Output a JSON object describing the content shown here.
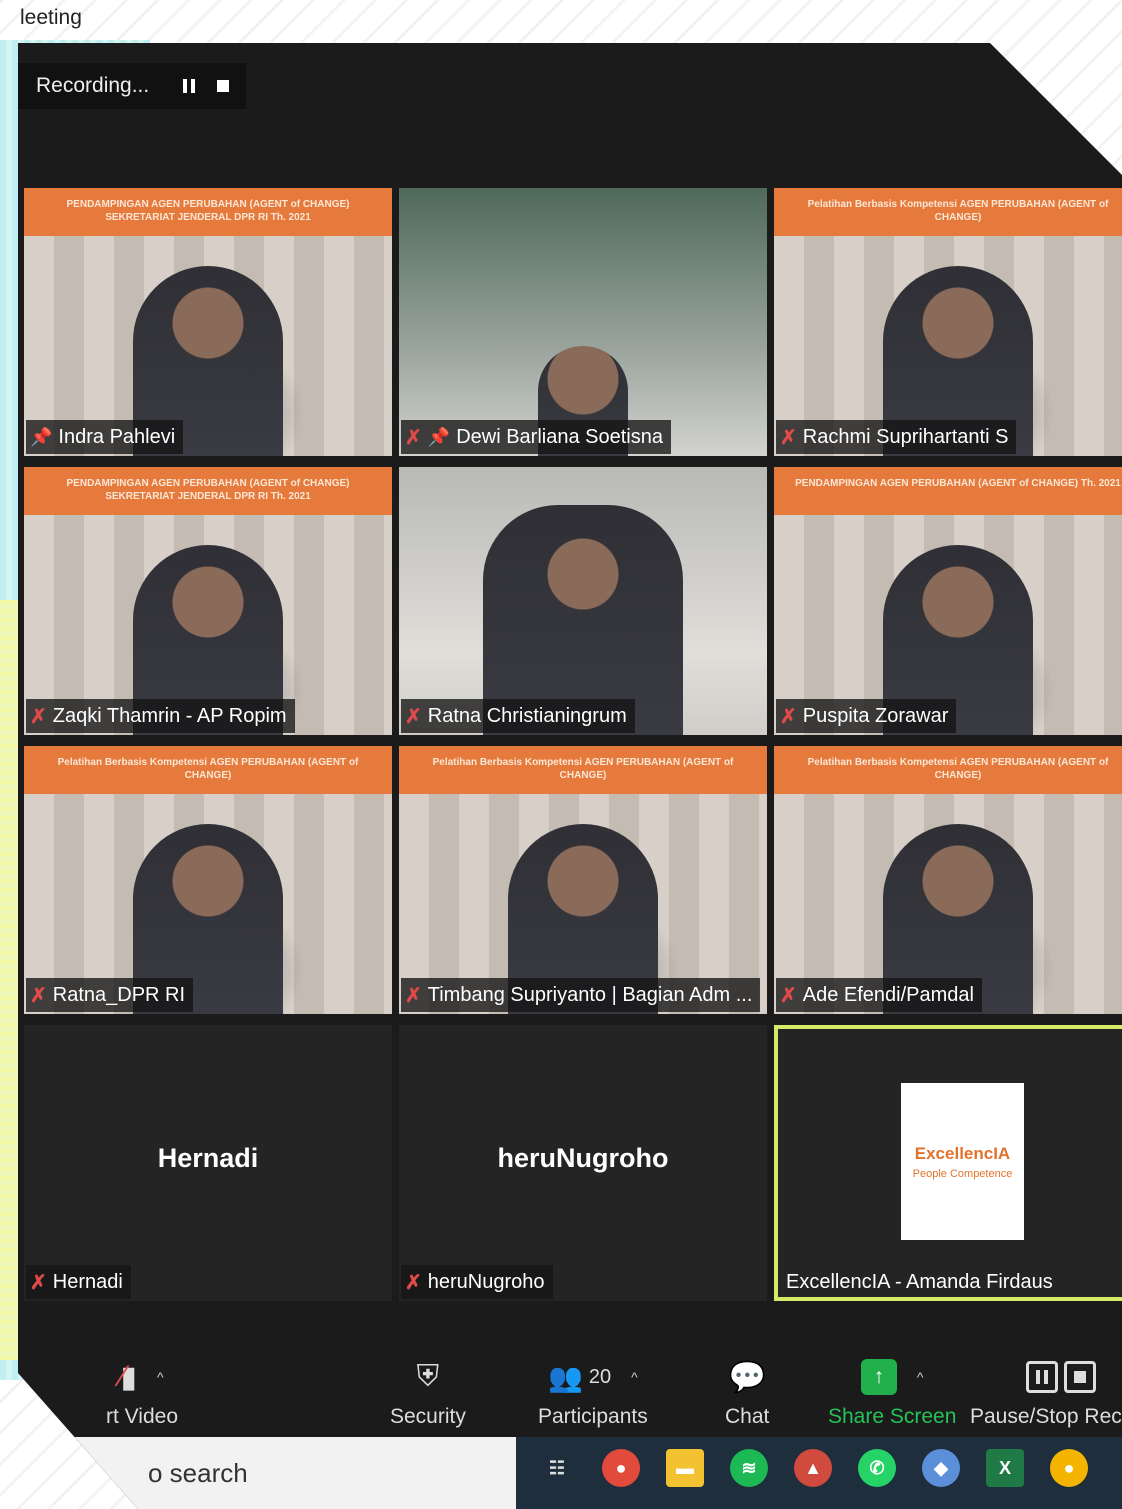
{
  "window": {
    "title": "leeting"
  },
  "recording": {
    "label": "Recording..."
  },
  "participants": [
    {
      "name": "Indra Pahlevi",
      "banner": "PENDAMPINGAN AGEN PERUBAHAN (AGENT of CHANGE) SEKRETARIAT JENDERAL DPR RI Th. 2021",
      "mic_muted": false,
      "pinned": true
    },
    {
      "name": "Dewi Barliana Soetisna",
      "banner": "",
      "mic_muted": true,
      "pinned": true
    },
    {
      "name": "Rachmi Suprihartanti S",
      "banner": "Pelatihan Berbasis Kompetensi AGEN PERUBAHAN (AGENT of CHANGE)",
      "mic_muted": true,
      "pinned": false
    },
    {
      "name": "Zaqki Thamrin - AP Ropim",
      "banner": "PENDAMPINGAN AGEN PERUBAHAN (AGENT of CHANGE) SEKRETARIAT JENDERAL DPR RI Th. 2021",
      "mic_muted": true,
      "pinned": false
    },
    {
      "name": "Ratna Christianingrum",
      "banner": "",
      "mic_muted": true,
      "pinned": false
    },
    {
      "name": "Puspita Zorawar",
      "banner": "PENDAMPINGAN AGEN PERUBAHAN (AGENT of CHANGE) Th. 2021",
      "mic_muted": true,
      "pinned": false
    },
    {
      "name": "Ratna_DPR RI",
      "banner": "Pelatihan Berbasis Kompetensi AGEN PERUBAHAN (AGENT of CHANGE)",
      "mic_muted": true,
      "pinned": false
    },
    {
      "name": "Timbang Supriyanto | Bagian Adm ...",
      "banner": "Pelatihan Berbasis Kompetensi AGEN PERUBAHAN (AGENT of CHANGE)",
      "mic_muted": true,
      "pinned": false
    },
    {
      "name": "Ade Efendi/Pamdal",
      "banner": "Pelatihan Berbasis Kompetensi AGEN PERUBAHAN (AGENT of CHANGE)",
      "mic_muted": true,
      "pinned": false
    },
    {
      "name": "Hernadi",
      "display_text": "Hernadi",
      "mic_muted": true
    },
    {
      "name": "heruNugroho",
      "display_text": "heruNugroho",
      "mic_muted": true
    },
    {
      "name": "ExcellencIA - Amanda Firdaus",
      "logo_text": "ExcellencIA",
      "logo_sub": "People Competence",
      "active": true
    }
  ],
  "toolbar": {
    "video_label": "rt Video",
    "security_label": "Security",
    "participants_label": "Participants",
    "participants_count": "20",
    "chat_label": "Chat",
    "share_label": "Share Screen",
    "record_label": "Pause/Stop Record"
  },
  "taskbar": {
    "search_placeholder": "o search"
  },
  "colors": {
    "active_speaker": "#d7ea67",
    "share_green": "#21b04b",
    "mic_muted": "#e04a4a",
    "banner_orange": "#e67a3c"
  }
}
